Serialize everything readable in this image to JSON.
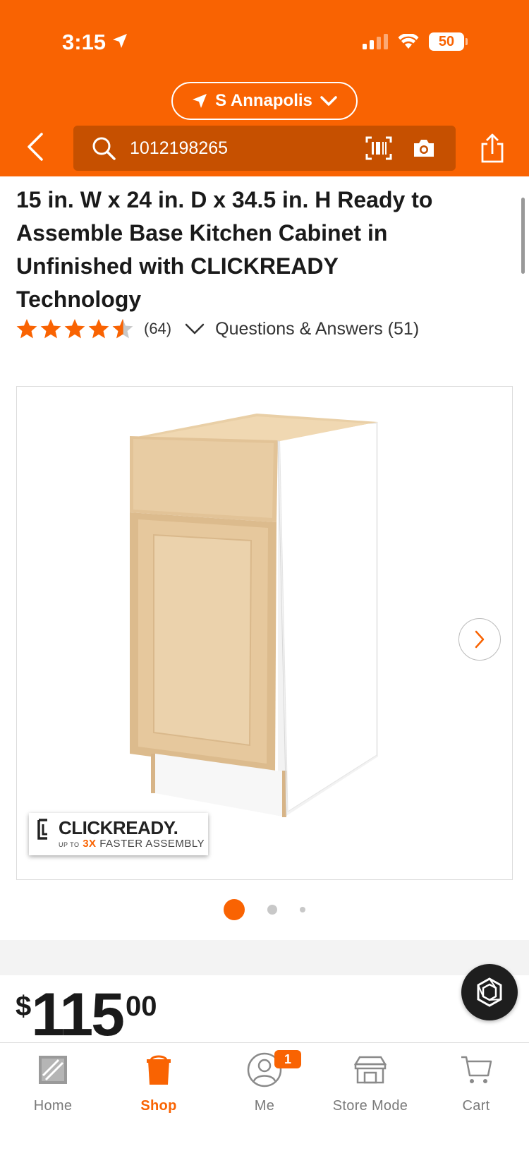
{
  "status_bar": {
    "time": "3:15",
    "battery": "50"
  },
  "header": {
    "store_name": "S Annapolis",
    "search_value": "1012198265"
  },
  "product": {
    "title": "15 in. W x 24 in. D x 34.5 in. H Ready to Assemble Base Kitchen Cabinet in Unfinished with CLICKREADY Technology",
    "rating": 4.5,
    "review_count": "(64)",
    "qa_label": "Questions & Answers (51)"
  },
  "gallery": {
    "badge_brand": "CLICKREADY.",
    "badge_up_to": "UP TO",
    "badge_highlight": "3X",
    "badge_rest": "FASTER ASSEMBLY",
    "current_image": 1,
    "image_count": 3
  },
  "price": {
    "currency": "$",
    "dollars": "115",
    "cents": "00"
  },
  "bottom_nav": {
    "items": [
      {
        "label": "Home",
        "icon": "home-depot-logo-icon"
      },
      {
        "label": "Shop",
        "icon": "shop-bucket-icon"
      },
      {
        "label": "Me",
        "icon": "user-icon",
        "badge": "1"
      },
      {
        "label": "Store Mode",
        "icon": "store-icon"
      },
      {
        "label": "Cart",
        "icon": "cart-icon"
      }
    ],
    "active": "Shop"
  },
  "colors": {
    "brand_orange": "#f96302",
    "search_bg": "#c65000"
  }
}
